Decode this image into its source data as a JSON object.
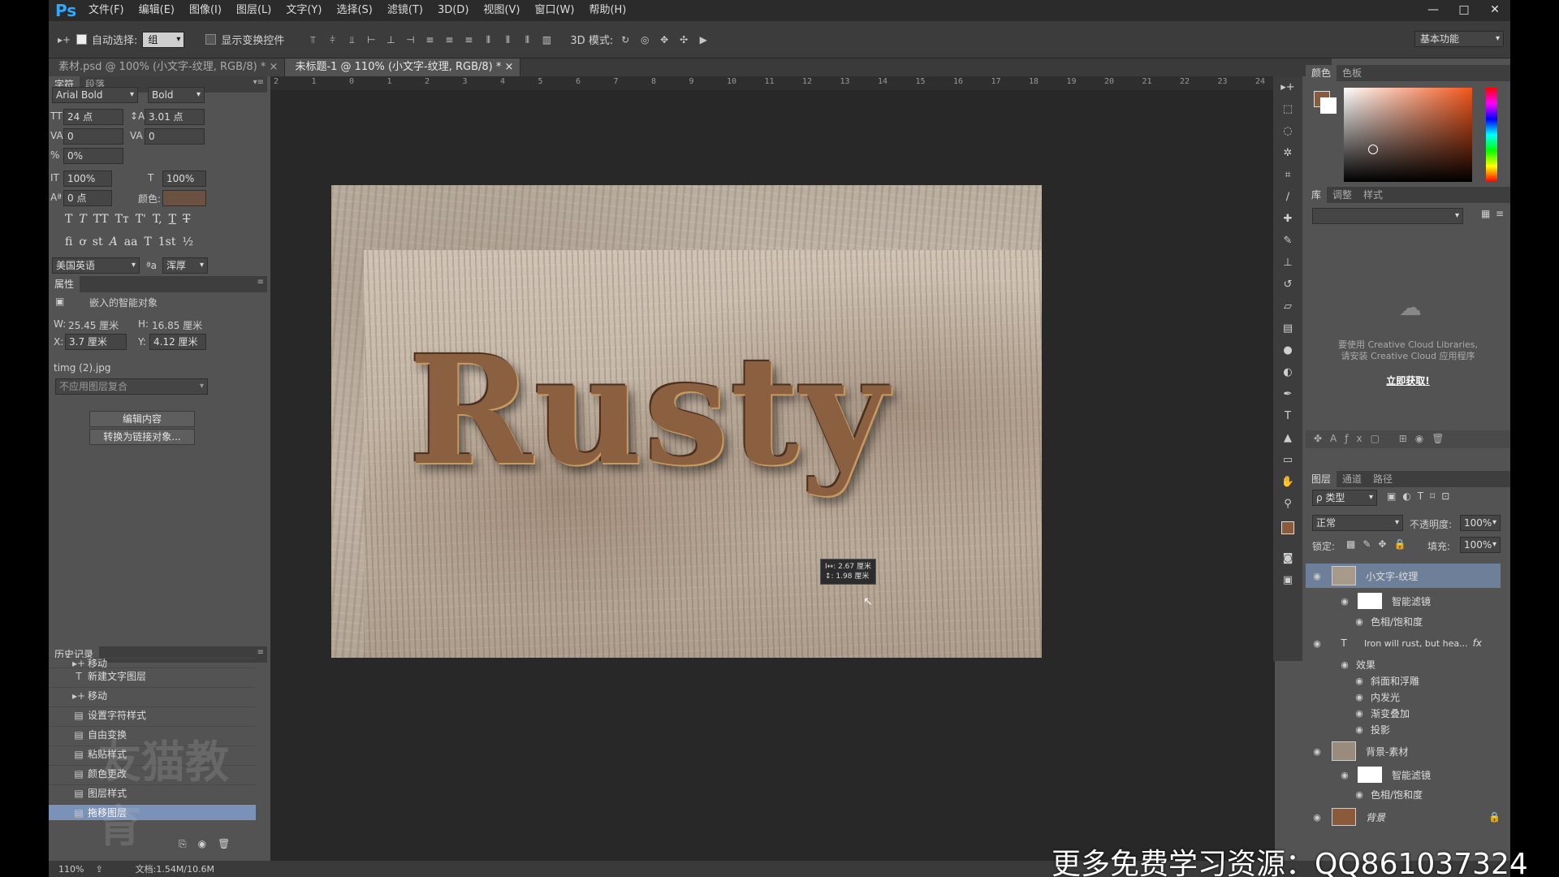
{
  "app": {
    "logo": "Ps",
    "menu": [
      "文件(F)",
      "编辑(E)",
      "图像(I)",
      "图层(L)",
      "文字(Y)",
      "选择(S)",
      "滤镜(T)",
      "3D(D)",
      "视图(V)",
      "窗口(W)",
      "帮助(H)"
    ],
    "window_buttons": [
      "—",
      "□",
      "✕"
    ]
  },
  "options": {
    "auto_select_label": "自动选择:",
    "auto_select_value": "组",
    "show_transform_label": "显示变换控件",
    "mode_3d_label": "3D 模式:",
    "workspace": "基本功能"
  },
  "tabs": [
    {
      "label": "素材.psd @ 100% (小文字-纹理, RGB/8) *",
      "active": false
    },
    {
      "label": "未标题-1 @ 110% (小文字-纹理, RGB/8) *",
      "active": true
    }
  ],
  "ruler": [
    "2",
    "1",
    "0",
    "1",
    "2",
    "3",
    "4",
    "5",
    "6",
    "7",
    "8",
    "9",
    "10",
    "11",
    "12",
    "13",
    "14",
    "15",
    "16",
    "17",
    "18",
    "19",
    "20",
    "21",
    "22",
    "23",
    "24"
  ],
  "character": {
    "tabs": [
      "字符",
      "段落"
    ],
    "font_family": "Arial Bold",
    "font_style": "Bold",
    "size": "24 点",
    "leading": "3.01 点",
    "kerning": "0",
    "tracking": "0",
    "scale_pct": "0%",
    "vertical_scale": "100%",
    "horizontal_scale": "100%",
    "baseline": "0 点",
    "color_label": "颜色:",
    "language": "美国英语",
    "aa_label": "ªa",
    "antialias": "浑厚",
    "typo_row1": [
      "T",
      "T",
      "TT",
      "Tт",
      "T'",
      "T,",
      "T",
      "T"
    ],
    "typo_row2": [
      "fi",
      "ơ",
      "st",
      "A",
      "aa",
      "T",
      "1st",
      "½"
    ]
  },
  "properties": {
    "title": "属性",
    "object_label": "嵌入的智能对象",
    "w_label": "W:",
    "w_value": "25.45 厘米",
    "h_label": "H:",
    "h_value": "16.85 厘米",
    "x_label": "X:",
    "x_value": "3.7 厘米",
    "y_label": "Y:",
    "y_value": "4.12 厘米",
    "filename": "timg (2).jpg",
    "comp_placeholder": "不应用图层复合",
    "edit_button": "编辑内容",
    "convert_button": "转换为链接对象..."
  },
  "history": {
    "title": "历史记录",
    "items": [
      {
        "icon": "▸+",
        "label": "移动"
      },
      {
        "icon": "T",
        "label": "新建文字图层"
      },
      {
        "icon": "▸+",
        "label": "移动"
      },
      {
        "icon": "▤",
        "label": "设置字符样式"
      },
      {
        "icon": "▤",
        "label": "自由变换"
      },
      {
        "icon": "▤",
        "label": "粘贴样式"
      },
      {
        "icon": "▤",
        "label": "颜色更改"
      },
      {
        "icon": "▤",
        "label": "图层样式"
      },
      {
        "icon": "▤",
        "label": "拖移图层"
      }
    ]
  },
  "canvas": {
    "text": "Rusty",
    "tooltip_line1": "I↔: 2.67 厘米",
    "tooltip_line2": "↕: 1.98 厘米"
  },
  "color_panel": {
    "tabs": [
      "颜色",
      "色板"
    ],
    "fg": "#8a5a3a",
    "bg": "#ffffff"
  },
  "library": {
    "tabs": [
      "库",
      "调整",
      "样式"
    ],
    "message1": "要使用 Creative Cloud Libraries,",
    "message2": "请安装 Creative Cloud 应用程序",
    "link": "立即获取!"
  },
  "layers": {
    "tabs": [
      "图层",
      "通道",
      "路径"
    ],
    "filter": "ρ 类型",
    "blend": "正常",
    "opacity_label": "不透明度:",
    "opacity": "100%",
    "lock_label": "锁定:",
    "fill_label": "填充:",
    "fill": "100%",
    "rows": [
      {
        "name": "小文字-纹理",
        "kind": "layer"
      },
      {
        "name": "智能滤镜",
        "kind": "sub"
      },
      {
        "name": "色相/饱和度",
        "kind": "subsub"
      },
      {
        "name": "Iron will rust, but hea...",
        "kind": "text"
      },
      {
        "name": "效果",
        "kind": "sub"
      },
      {
        "name": "斜面和浮雕",
        "kind": "subsub"
      },
      {
        "name": "内发光",
        "kind": "subsub"
      },
      {
        "name": "渐变叠加",
        "kind": "subsub"
      },
      {
        "name": "投影",
        "kind": "subsub"
      },
      {
        "name": "背景-素材",
        "kind": "layer"
      },
      {
        "name": "智能滤镜",
        "kind": "sub"
      },
      {
        "name": "色相/饱和度",
        "kind": "subsub"
      },
      {
        "name": "背景",
        "kind": "bg"
      }
    ]
  },
  "status": {
    "zoom": "110%",
    "doc": "文档:1.54M/10.6M"
  },
  "overlay": {
    "watermark": "更多免费学习资源：QQ861037324",
    "brand": "友猫教育"
  }
}
